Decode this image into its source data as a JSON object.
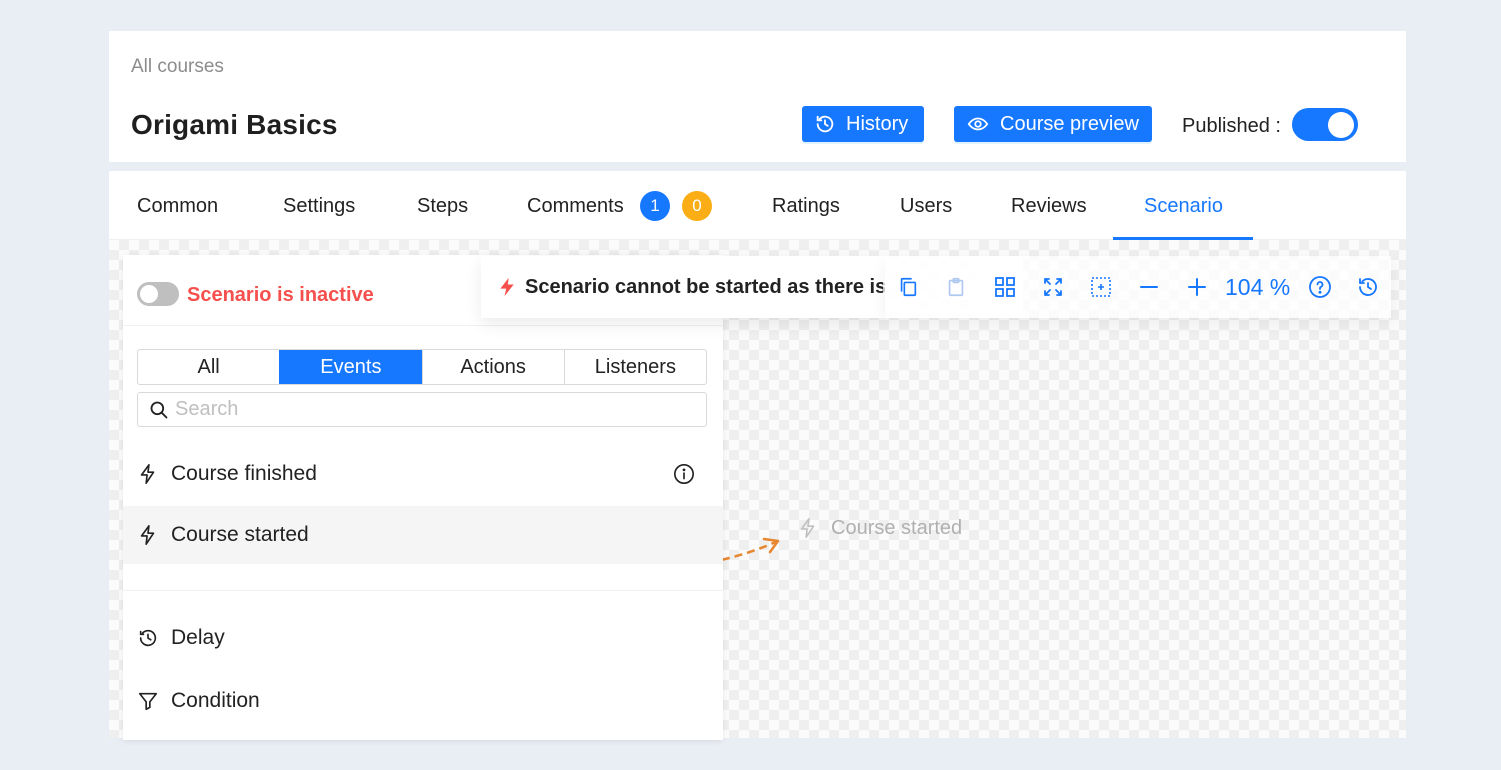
{
  "header": {
    "breadcrumb": "All courses",
    "title": "Origami Basics",
    "history_label": "History",
    "preview_label": "Course preview",
    "published_label": "Published :",
    "published_on": true
  },
  "tabs": [
    {
      "label": "Common"
    },
    {
      "label": "Settings"
    },
    {
      "label": "Steps"
    },
    {
      "label": "Comments"
    },
    {
      "label": "Ratings"
    },
    {
      "label": "Users"
    },
    {
      "label": "Reviews"
    },
    {
      "label": "Scenario",
      "active": true
    }
  ],
  "comment_badges": {
    "blue": "1",
    "orange": "0"
  },
  "panel": {
    "status": "Scenario is inactive",
    "segments": [
      {
        "label": "All"
      },
      {
        "label": "Events",
        "active": true
      },
      {
        "label": "Actions"
      },
      {
        "label": "Listeners"
      }
    ],
    "search_placeholder": "Search",
    "events": [
      {
        "label": "Course finished",
        "icon": "lightning-icon"
      },
      {
        "label": "Course started",
        "icon": "lightning-icon",
        "highlighted": true
      }
    ],
    "extras": [
      {
        "label": "Delay",
        "icon": "clock-icon"
      },
      {
        "label": "Condition",
        "icon": "filter-icon"
      }
    ]
  },
  "alert": {
    "text": "Scenario cannot be started as there is no start event"
  },
  "toolbar": {
    "zoom": "104 %"
  },
  "canvas_node": {
    "label": "Course started"
  },
  "colors": {
    "accent": "#1677ff",
    "danger": "#f5504d",
    "warning": "#faad14",
    "drag_arrow": "#e8862f"
  }
}
